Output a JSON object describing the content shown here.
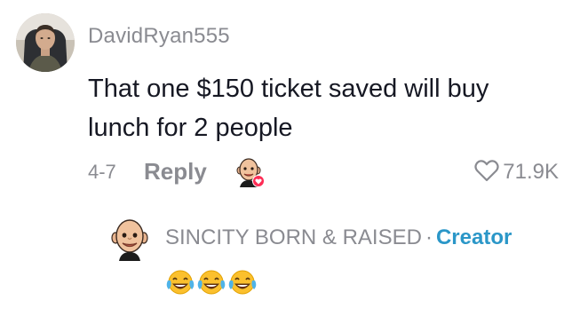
{
  "comment": {
    "username": "DavidRyan555",
    "text": "That one $150 ticket saved will buy lunch for 2 people",
    "date": "4-7",
    "reply_label": "Reply",
    "like_count": "71.9K"
  },
  "reply": {
    "username": "SINCITY BORN & RAISED",
    "separator": "·",
    "badge": "Creator",
    "emojis": [
      "laughing-tears-emoji",
      "laughing-tears-emoji",
      "laughing-tears-emoji"
    ]
  },
  "colors": {
    "secondary_text": "#8a8b91",
    "creator_accent": "#2b97c8",
    "like_heart_badge": "#fe2c55"
  },
  "icons": {
    "heart": "heart-outline-icon",
    "creator_liked": "creator-liked-badge"
  }
}
